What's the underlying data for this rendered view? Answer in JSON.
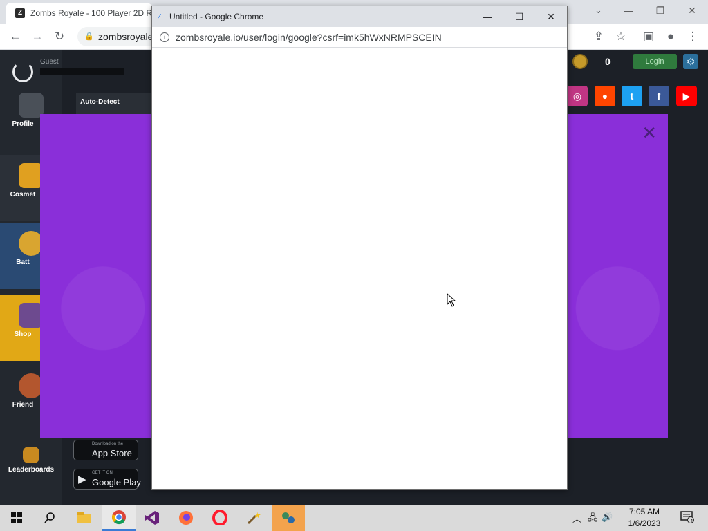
{
  "background_window": {
    "tab_title": "Zombs Royale - 100 Player 2D R",
    "tab_favicon": "Z",
    "url_partial": "zombsroyale",
    "window_controls": {
      "minimize": "—",
      "maximize": "❐",
      "close": "✕"
    },
    "toolbar": {
      "back": "←",
      "forward": "→",
      "reload": "↻",
      "share": "⇪",
      "bookmark": "☆",
      "sidepanel": "▣",
      "profile": "●",
      "menu": "⋮"
    }
  },
  "game": {
    "guest_label": "Guest",
    "auto_detect_label": "Auto-Detect",
    "coins": "0",
    "login_label": "Login",
    "settings_icon": "⚙",
    "sidebar": [
      {
        "label": "Profile"
      },
      {
        "label": "Cosmet"
      },
      {
        "label": "Batt"
      },
      {
        "label": "Shop"
      },
      {
        "label": "Friend"
      },
      {
        "label": "Leaderboards"
      }
    ],
    "socials": [
      {
        "name": "instagram",
        "glyph": "◎",
        "color": "#c13584"
      },
      {
        "name": "reddit",
        "glyph": "●",
        "color": "#ff4500"
      },
      {
        "name": "twitter",
        "glyph": "t",
        "color": "#1da1f2"
      },
      {
        "name": "facebook",
        "glyph": "f",
        "color": "#3b5998"
      },
      {
        "name": "youtube",
        "glyph": "▶",
        "color": "#ff0000"
      }
    ],
    "store": {
      "apple_sub": "Download on the",
      "apple_name": "App Store",
      "google_sub": "GET IT ON",
      "google_name": "Google Play"
    },
    "modal_close": "✕",
    "modal_color": "#8a2fd9"
  },
  "popup": {
    "title": "Untitled - Google Chrome",
    "url": "zombsroyale.io/user/login/google?csrf=imk5hWxNRMPSCEIN",
    "info_icon": "i",
    "controls": {
      "minimize": "—",
      "maximize": "☐",
      "close": "✕"
    }
  },
  "taskbar": {
    "time": "7:05 AM",
    "date": "1/6/2023",
    "notification_count": "1"
  }
}
